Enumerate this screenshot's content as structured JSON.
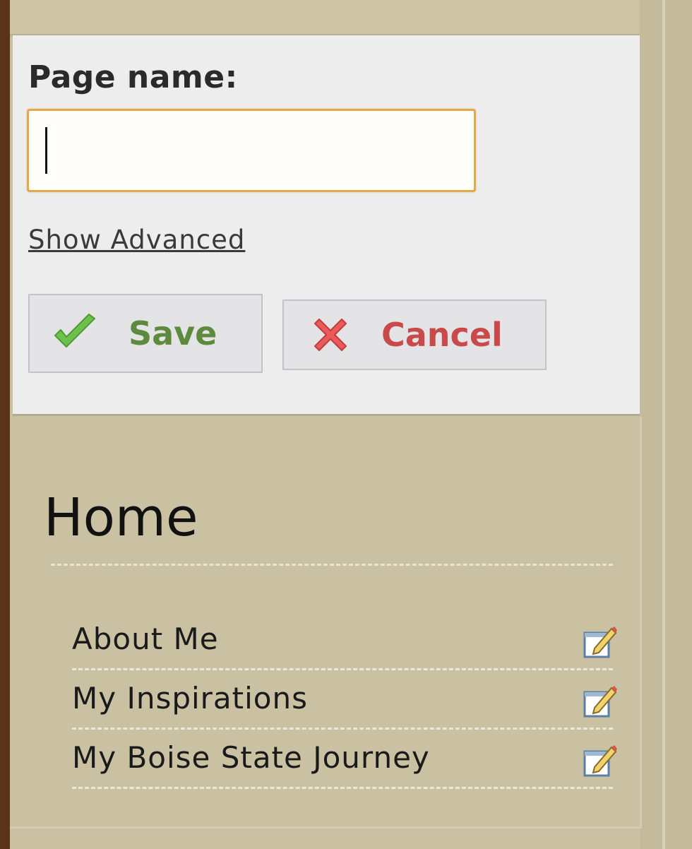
{
  "form": {
    "page_name_label": "Page name:",
    "page_name_value": "",
    "show_advanced": "Show Advanced",
    "save_label": "Save",
    "cancel_label": "Cancel"
  },
  "nav": {
    "title": "Home",
    "items": [
      {
        "label": "About Me",
        "icon": "edit-icon"
      },
      {
        "label": "My Inspirations",
        "icon": "edit-icon"
      },
      {
        "label": "My Boise State Journey",
        "icon": "edit-icon"
      }
    ]
  },
  "colors": {
    "background": "#c9c1a1",
    "form_panel": "#ededee",
    "input_border": "#e2a94a",
    "save_text": "#5d8a3c",
    "cancel_text": "#c94a4a",
    "left_bar": "#5a3417"
  }
}
